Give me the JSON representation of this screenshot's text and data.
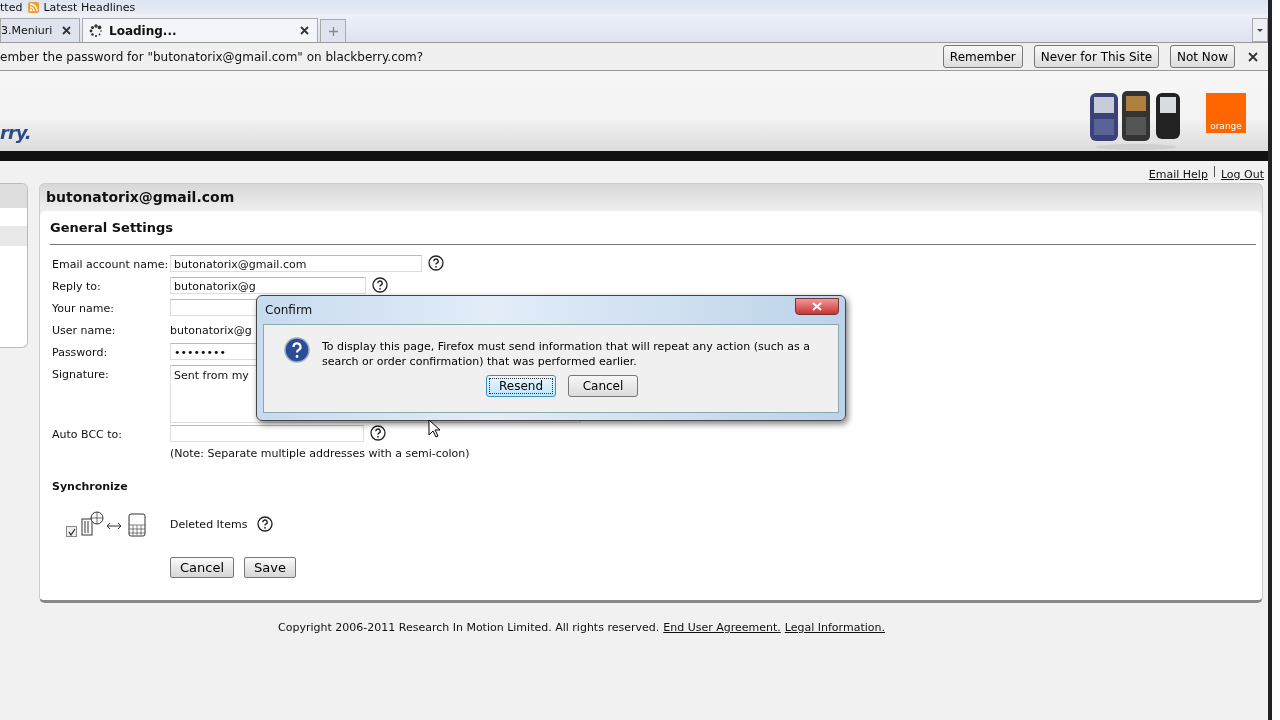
{
  "browser": {
    "bookmarks": [
      {
        "label": "tted",
        "kind": "plain"
      },
      {
        "label": "Latest Headlines",
        "kind": "feed"
      }
    ],
    "tabs": [
      {
        "label": "3.Meniuri",
        "selected": false,
        "loading": false
      },
      {
        "label": "Loading...",
        "selected": true,
        "loading": true
      }
    ],
    "notification": {
      "message": "ember the password for \"butonatorix@gmail.com\" on blackberry.com?",
      "buttons": [
        "Remember",
        "Never for This Site",
        "Not Now"
      ]
    }
  },
  "header": {
    "logo_text": "rry.",
    "carrier_logo": "orange"
  },
  "top_links": [
    "Email Help",
    "Log Out"
  ],
  "account": {
    "title": "butonatorix@gmail.com"
  },
  "settings": {
    "heading": "General Settings",
    "fields": [
      {
        "label": "Email account name:",
        "kind": "input",
        "value": "butonatorix@gmail.com",
        "help": true
      },
      {
        "label": "Reply to:",
        "kind": "input",
        "value": "butonatorix@g",
        "help": true
      },
      {
        "label": "Your name:",
        "kind": "input",
        "help": false
      },
      {
        "label": "User name:",
        "kind": "text",
        "value": "butonatorix@g",
        "help": false
      },
      {
        "label": "Password:",
        "kind": "input",
        "value": "••••••••",
        "help": false
      },
      {
        "label": "Signature:",
        "kind": "textarea",
        "value": "Sent from my",
        "help": false
      },
      {
        "label": "Auto BCC to:",
        "kind": "input",
        "help": true,
        "note": "(Note: Separate multiple addresses with a semi-colon)"
      }
    ],
    "sync_heading": "Synchronize",
    "sync_items": [
      {
        "label": "Deleted Items",
        "checked": true,
        "help": true
      }
    ],
    "buttons": [
      "Cancel",
      "Save"
    ]
  },
  "footer": {
    "text": "Copyright 2006-2011 Research In Motion Limited. All rights reserved.",
    "links": [
      "End User Agreement.",
      "Legal Information."
    ]
  },
  "dialog": {
    "title": "Confirm",
    "message": "To display this page, Firefox must send information that will repeat any action (such as a search or order confirmation) that was performed earlier.",
    "buttons": [
      {
        "label": "Resend",
        "selected": true
      },
      {
        "label": "Cancel",
        "selected": false
      }
    ]
  }
}
